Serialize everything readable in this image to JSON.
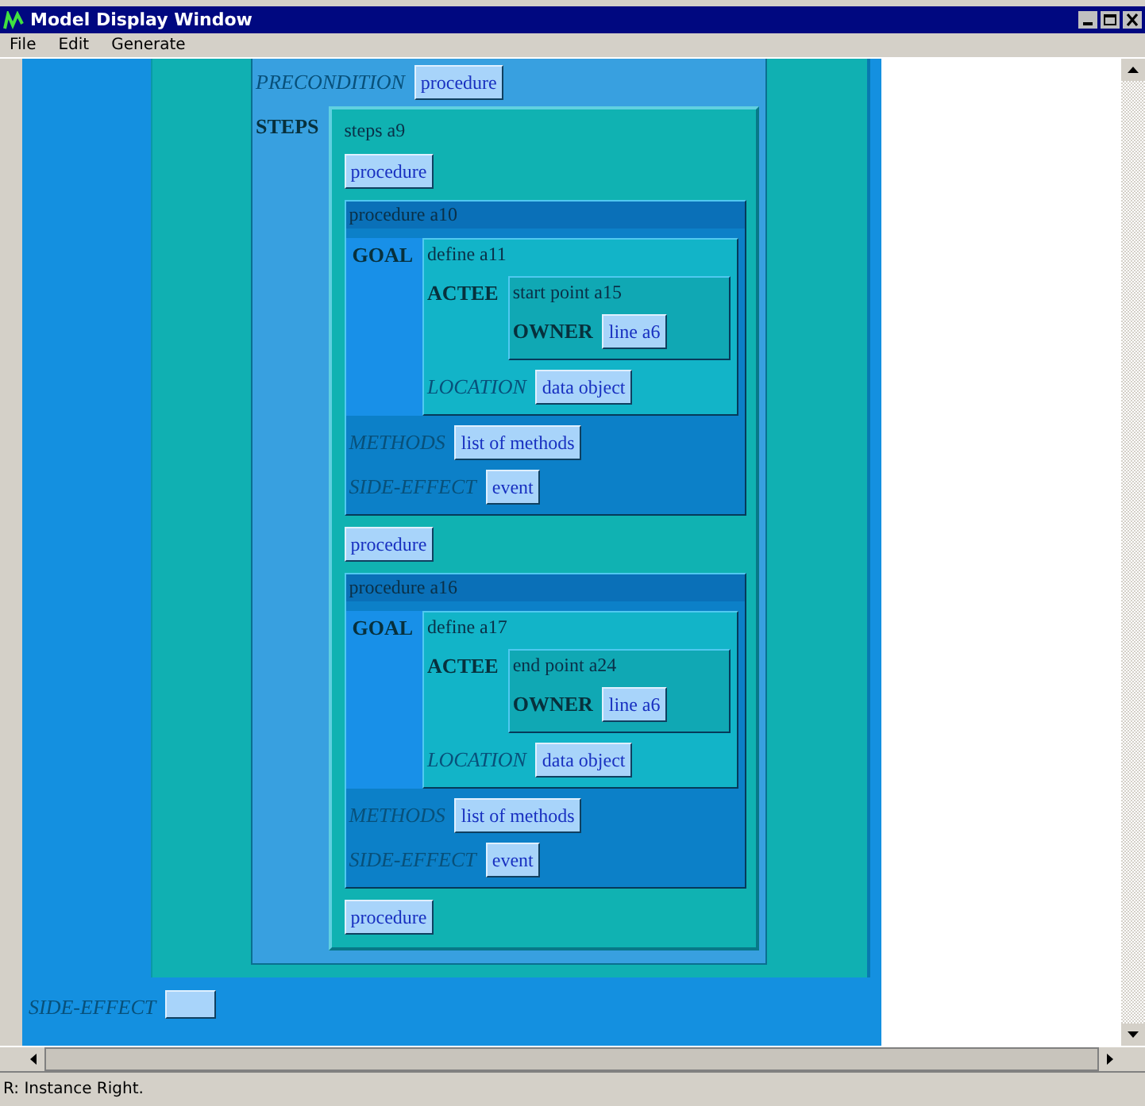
{
  "window": {
    "title": "Model Display Window"
  },
  "menu": [
    "File",
    "Edit",
    "Generate"
  ],
  "canvas": {
    "slots": [
      {
        "label": "PRECONDITION",
        "kind": "italic",
        "value": {
          "kind": "button",
          "text": "procedure"
        }
      },
      {
        "label": "STEPS",
        "kind": "bold",
        "value": {
          "kind": "list",
          "title": "steps a9",
          "items": [
            {
              "kind": "button",
              "text": "procedure"
            },
            {
              "kind": "instance",
              "title": "procedure a10",
              "slots": [
                {
                  "label": "GOAL",
                  "kind": "bold",
                  "value": {
                    "kind": "instance",
                    "title": "define a11",
                    "slots": [
                      {
                        "label": "ACTEE",
                        "kind": "bold",
                        "value": {
                          "kind": "instance",
                          "title": "start point a15",
                          "slots": [
                            {
                              "label": "OWNER",
                              "kind": "bold",
                              "value": {
                                "kind": "button",
                                "text": "line a6"
                              }
                            }
                          ]
                        }
                      },
                      {
                        "label": "LOCATION",
                        "kind": "italic",
                        "value": {
                          "kind": "button",
                          "text": "data object"
                        }
                      }
                    ]
                  }
                },
                {
                  "label": "METHODS",
                  "kind": "italic",
                  "value": {
                    "kind": "button",
                    "text": "list of methods"
                  }
                },
                {
                  "label": "SIDE-EFFECT",
                  "kind": "italic",
                  "value": {
                    "kind": "button",
                    "text": "event"
                  }
                }
              ]
            },
            {
              "kind": "button",
              "text": "procedure"
            },
            {
              "kind": "instance",
              "title": "procedure a16",
              "slots": [
                {
                  "label": "GOAL",
                  "kind": "bold",
                  "value": {
                    "kind": "instance",
                    "title": "define a17",
                    "slots": [
                      {
                        "label": "ACTEE",
                        "kind": "bold",
                        "value": {
                          "kind": "instance",
                          "title": "end point a24",
                          "slots": [
                            {
                              "label": "OWNER",
                              "kind": "bold",
                              "value": {
                                "kind": "button",
                                "text": "line a6"
                              }
                            }
                          ]
                        }
                      },
                      {
                        "label": "LOCATION",
                        "kind": "italic",
                        "value": {
                          "kind": "button",
                          "text": "data object"
                        }
                      }
                    ]
                  }
                },
                {
                  "label": "METHODS",
                  "kind": "italic",
                  "value": {
                    "kind": "button",
                    "text": "list of methods"
                  }
                },
                {
                  "label": "SIDE-EFFECT",
                  "kind": "italic",
                  "value": {
                    "kind": "button",
                    "text": "event"
                  }
                }
              ]
            },
            {
              "kind": "button",
              "text": "procedure"
            }
          ]
        }
      }
    ],
    "bottom_slots": [
      {
        "label": "SIDE-EFFECT",
        "kind": "italic",
        "value": {
          "kind": "button"
        }
      }
    ]
  },
  "status_bar": "R: Instance Right."
}
